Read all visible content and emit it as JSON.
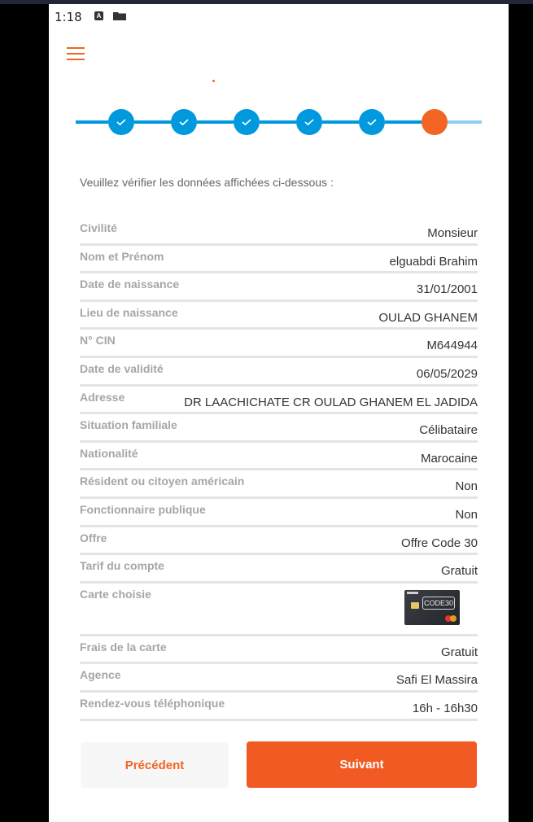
{
  "status_bar": {
    "time": "1:18",
    "icons": [
      "a-icon",
      "folder-icon"
    ]
  },
  "colors": {
    "accent": "#f26522",
    "step_done": "#0099dd",
    "step_pending": "#8fd0f0",
    "next_button": "#f15a22"
  },
  "stepper": {
    "steps": [
      {
        "state": "done"
      },
      {
        "state": "done"
      },
      {
        "state": "done"
      },
      {
        "state": "done"
      },
      {
        "state": "done"
      },
      {
        "state": "current"
      }
    ]
  },
  "intro": "Veuillez vérifier les données affichées ci-dessous :",
  "fields": [
    {
      "label": "Civilité",
      "value": "Monsieur"
    },
    {
      "label": "Nom et Prénom",
      "value": "elguabdi Brahim"
    },
    {
      "label": "Date de naissance",
      "value": "31/01/2001"
    },
    {
      "label": "Lieu de naissance",
      "value": "OULAD GHANEM"
    },
    {
      "label": "N° CIN",
      "value": "M644944"
    },
    {
      "label": "Date de validité",
      "value": "06/05/2029"
    },
    {
      "label": "Adresse",
      "value": "DR LAACHICHATE CR OULAD GHANEM EL JADIDA"
    },
    {
      "label": "Situation familiale",
      "value": "Célibataire"
    },
    {
      "label": "Nationalité",
      "value": "Marocaine"
    },
    {
      "label": "Résident ou citoyen américain",
      "value": "Non"
    },
    {
      "label": "Fonctionnaire publique",
      "value": "Non"
    },
    {
      "label": "Offre",
      "value": "Offre Code 30"
    },
    {
      "label": "Tarif du compte",
      "value": "Gratuit"
    },
    {
      "label": "Carte choisie",
      "value": ""
    },
    {
      "label": "Frais de la carte",
      "value": "Gratuit"
    },
    {
      "label": "Agence",
      "value": "Safi El Massira"
    },
    {
      "label": "Rendez-vous téléphonique",
      "value": "16h - 16h30"
    }
  ],
  "card_logo_text": "CODE30",
  "buttons": {
    "previous": "Précédent",
    "next": "Suivant"
  }
}
